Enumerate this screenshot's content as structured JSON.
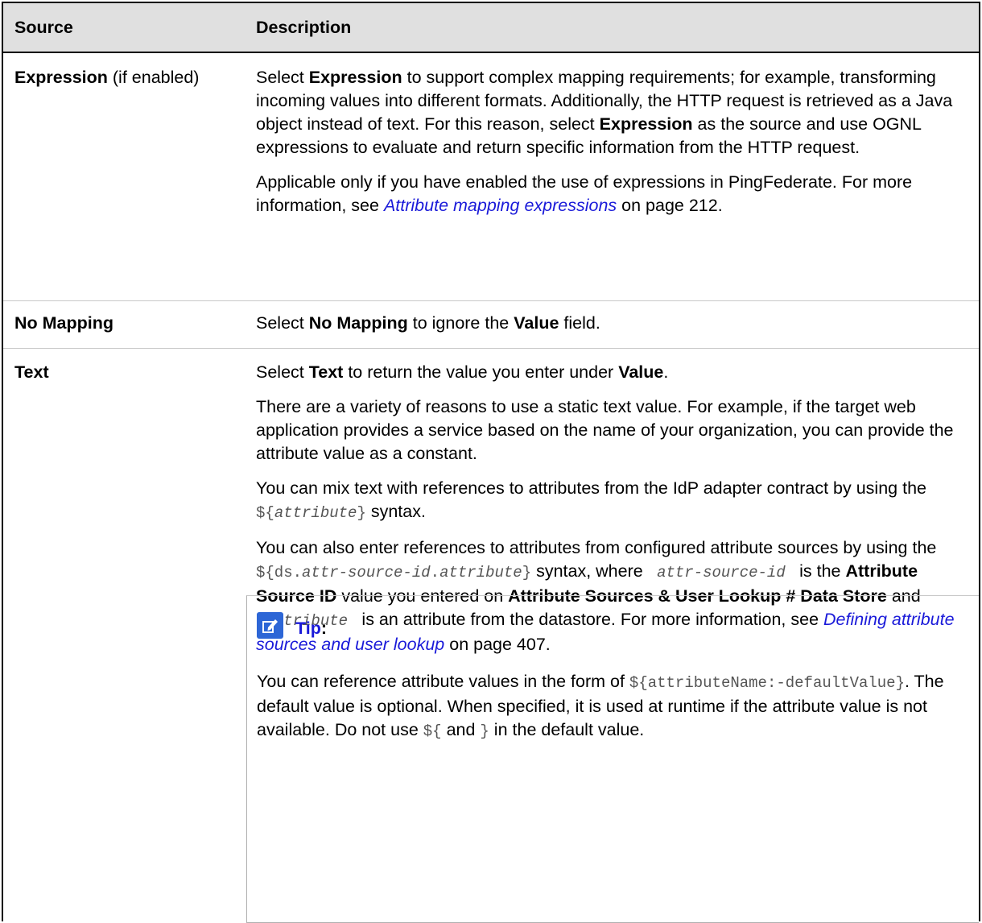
{
  "header": {
    "source": "Source",
    "description": "Description"
  },
  "rows": {
    "expression": {
      "source_bold": "Expression",
      "source_suffix": " (if enabled)",
      "p1": {
        "t1": "Select ",
        "b1": "Expression",
        "t2": " to support complex mapping requirements; for example, transforming incoming values into different formats. Additionally, the HTTP request is retrieved as a Java object instead of text. For this reason, select ",
        "b2": "Expression",
        "t3": " as the source and use OGNL expressions to evaluate and return specific information from the HTTP request."
      },
      "p2": {
        "t1": "Applicable only if you have enabled the use of expressions in PingFederate. For more information, see ",
        "link": "Attribute mapping expressions",
        "t2": " on page 212."
      }
    },
    "no_mapping": {
      "source": "No Mapping",
      "t1": "Select ",
      "b1": "No Mapping",
      "t2": " to ignore the ",
      "b2": "Value",
      "t3": " field."
    },
    "text": {
      "source": "Text",
      "p1": {
        "t1": "Select ",
        "b1": "Text",
        "t2": " to return the value you enter under ",
        "b2": "Value",
        "t3": "."
      },
      "p2": "There are a variety of reasons to use a static text value. For example, if the target web application provides a service based on the name of your organization, you can provide the attribute value as a constant.",
      "p3": {
        "t1": "You can mix text with references to attributes from the IdP adapter contract by using the ",
        "code_open": "${",
        "code_var": "attribute",
        "code_close": "}",
        "t2": " syntax."
      },
      "p4": {
        "t1": "You can also enter references to attributes from configured attribute sources by using the ",
        "c1": "${ds.",
        "c2": "attr-source-id",
        "c3": ".",
        "c4": "attribute",
        "c5": "}",
        "t2": " syntax, where ",
        "c6": "attr-source-id",
        "t3": " is the ",
        "b1": "Attribute Source ID",
        "t4": " value you entered on ",
        "b2": "Attribute Sources & User Lookup # Data Store",
        "t5": " and ",
        "c7": "attribute",
        "t6": " is an attribute from the datastore. For more information, see ",
        "link": "Defining attribute sources and user lookup",
        "t7": " on page 407."
      }
    }
  },
  "tip": {
    "icon": "pencil-note-icon",
    "label": "Tip",
    "colon": ":",
    "t1": "You can reference attribute values in the form of ",
    "c1": "${attributeName:-defaultValue}",
    "t2": ". The default value is optional. When specified, it is used at runtime if the attribute value is not available. Do not use ",
    "c2": "${",
    "t3": " and ",
    "c3": "}",
    "t4": " in the default value."
  },
  "colors": {
    "header_bg": "#e0e0e0",
    "link": "#1a1ad9",
    "tip_icon_bg": "#2d66d6"
  }
}
